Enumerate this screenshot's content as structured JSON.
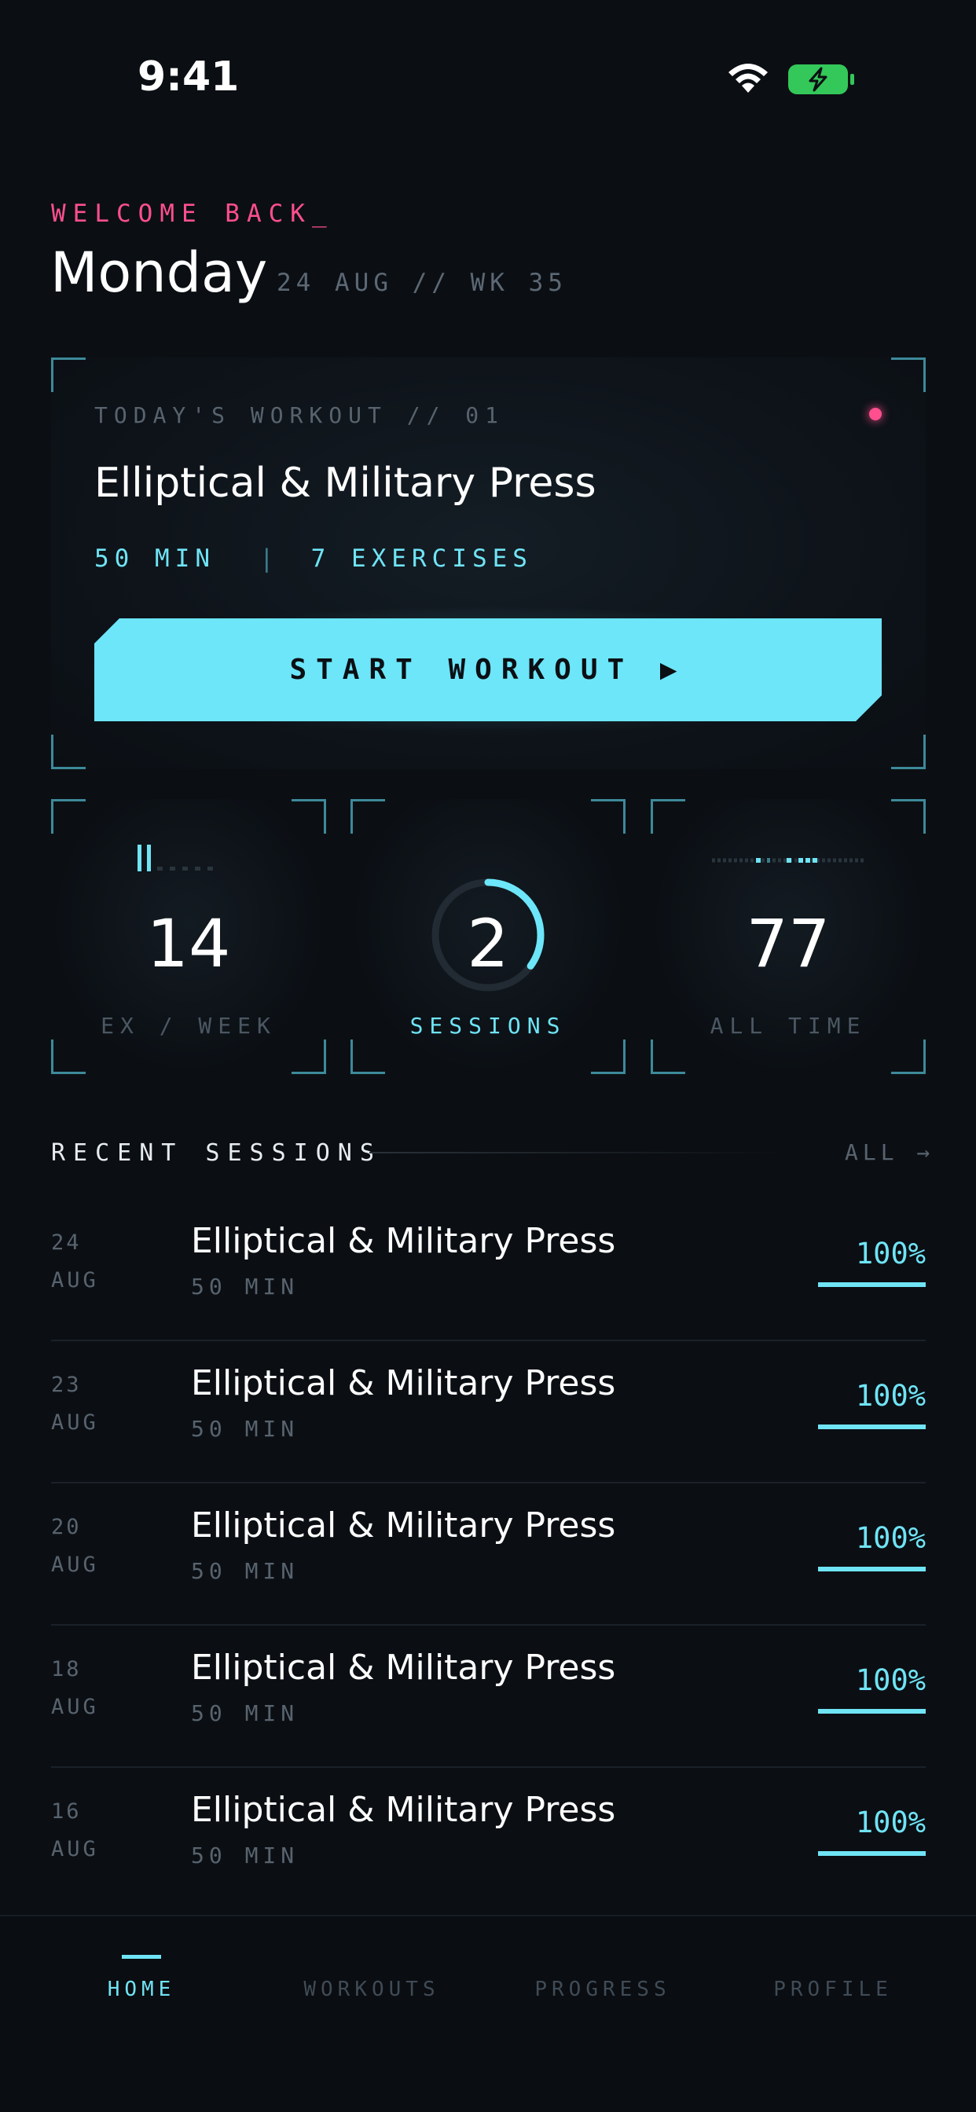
{
  "status_bar": {
    "time": "9:41"
  },
  "header": {
    "welcome": "WELCOME BACK_",
    "day": "Monday",
    "date": "24 AUG // WK 35"
  },
  "today": {
    "label": "TODAY'S WORKOUT // 01",
    "title": "Elliptical & Military Press",
    "duration": "50 MIN",
    "separator": "|",
    "exercises": "7 EXERCISES",
    "start_label": "START WORKOUT ▶"
  },
  "stats": [
    {
      "value": "14",
      "label": "EX / WEEK"
    },
    {
      "value": "2",
      "label": "SESSIONS",
      "ring_progress": 0.35
    },
    {
      "value": "77",
      "label": "ALL TIME"
    }
  ],
  "recent": {
    "label": "RECENT SESSIONS",
    "all_link": "ALL →",
    "sessions": [
      {
        "day": "24",
        "month": "AUG",
        "title": "Elliptical & Military Press",
        "duration": "50 MIN",
        "percent": "100%",
        "progress": 1.0
      },
      {
        "day": "23",
        "month": "AUG",
        "title": "Elliptical & Military Press",
        "duration": "50 MIN",
        "percent": "100%",
        "progress": 1.0
      },
      {
        "day": "20",
        "month": "AUG",
        "title": "Elliptical & Military Press",
        "duration": "50 MIN",
        "percent": "100%",
        "progress": 1.0
      },
      {
        "day": "18",
        "month": "AUG",
        "title": "Elliptical & Military Press",
        "duration": "50 MIN",
        "percent": "100%",
        "progress": 1.0
      },
      {
        "day": "16",
        "month": "AUG",
        "title": "Elliptical & Military Press",
        "duration": "50 MIN",
        "percent": "100%",
        "progress": 1.0
      }
    ]
  },
  "tabs": [
    {
      "label": "HOME",
      "active": true
    },
    {
      "label": "WORKOUTS",
      "active": false
    },
    {
      "label": "PROGRESS",
      "active": false
    },
    {
      "label": "PROFILE",
      "active": false
    }
  ],
  "colors": {
    "accent": "#6ce6f8",
    "pink": "#ff4f8f",
    "background": "#0b0f14"
  }
}
